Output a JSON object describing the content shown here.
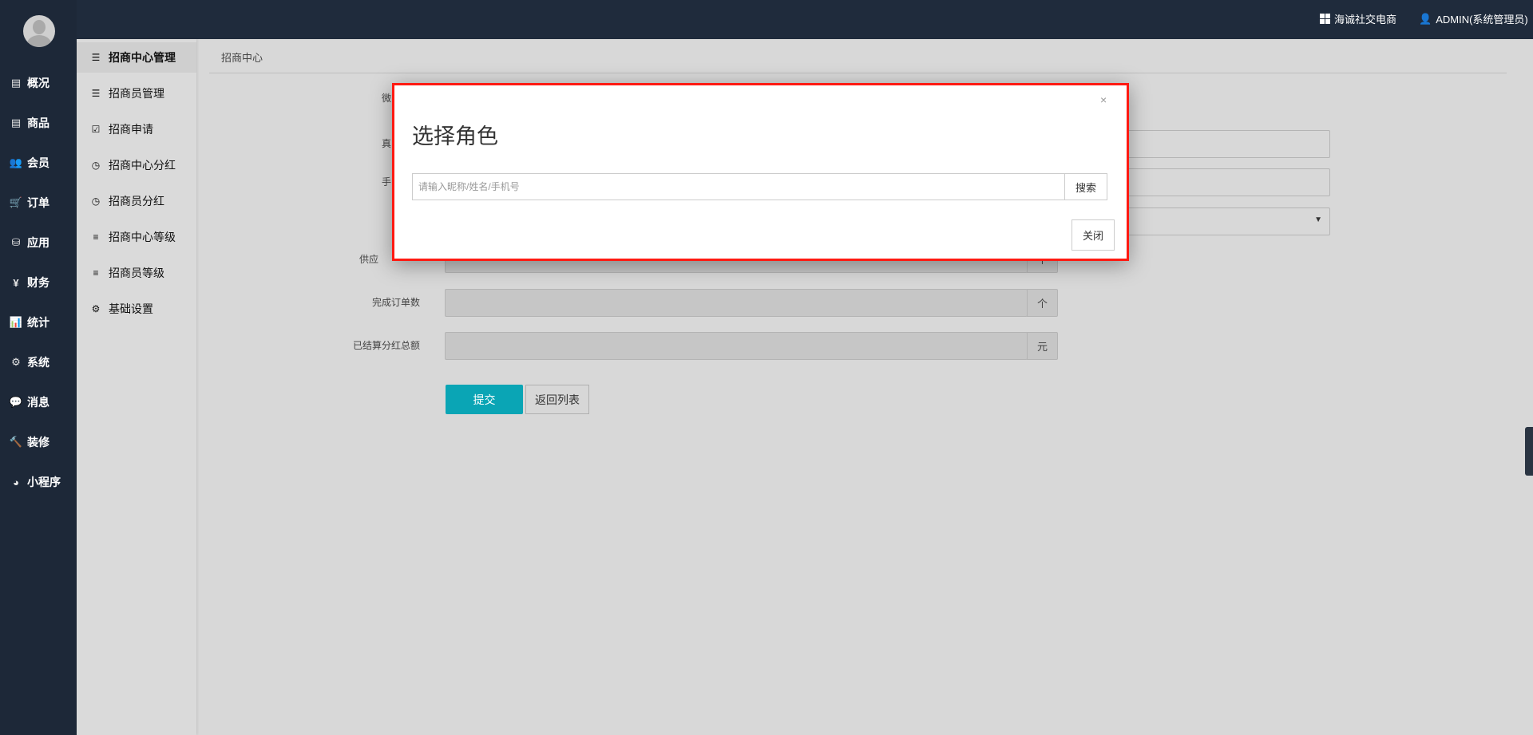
{
  "topbar": {
    "shop_name": "海诚社交电商",
    "user": "ADMIN(系统管理员)",
    "shop_icon": "dashboard-grid-icon",
    "user_icon": "user-icon"
  },
  "leftnav": [
    {
      "label": "概况",
      "icon": "archive-icon",
      "glyph": "▤"
    },
    {
      "label": "商品",
      "icon": "archive-icon",
      "glyph": "▤"
    },
    {
      "label": "会员",
      "icon": "users-icon",
      "glyph": "👥"
    },
    {
      "label": "订单",
      "icon": "cart-icon",
      "glyph": "🛒"
    },
    {
      "label": "应用",
      "icon": "cubes-icon",
      "glyph": "⛁"
    },
    {
      "label": "财务",
      "icon": "yen-icon",
      "glyph": "¥"
    },
    {
      "label": "统计",
      "icon": "bar-chart-icon",
      "glyph": "📊"
    },
    {
      "label": "系统",
      "icon": "cogs-icon",
      "glyph": "⚙"
    },
    {
      "label": "消息",
      "icon": "comment-icon",
      "glyph": "💬"
    },
    {
      "label": "装修",
      "icon": "gavel-icon",
      "glyph": "🔨"
    },
    {
      "label": "小程序",
      "icon": "wechat-icon",
      "glyph": "◕"
    }
  ],
  "subnav": [
    {
      "label": "招商中心管理",
      "icon": "list-icon",
      "glyph": "☰",
      "active": true
    },
    {
      "label": "招商员管理",
      "icon": "list-icon",
      "glyph": "☰"
    },
    {
      "label": "招商申请",
      "icon": "check-square-icon",
      "glyph": "☑"
    },
    {
      "label": "招商中心分红",
      "icon": "clock-icon",
      "glyph": "◷"
    },
    {
      "label": "招商员分红",
      "icon": "clock-icon",
      "glyph": "◷"
    },
    {
      "label": "招商中心等级",
      "icon": "align-left-icon",
      "glyph": "≡"
    },
    {
      "label": "招商员等级",
      "icon": "align-left-icon",
      "glyph": "≡"
    },
    {
      "label": "基础设置",
      "icon": "cogs-icon",
      "glyph": "⚙"
    }
  ],
  "breadcrumb": "招商中心",
  "form": {
    "label_fragments": [
      "微",
      "真",
      "手",
      "供应"
    ],
    "completed_orders_label": "完成订单数",
    "completed_orders_unit": "个",
    "settled_dividend_label": "已结算分红总额",
    "settled_dividend_unit": "元",
    "supplier_unit": "个",
    "submit": "提交",
    "back": "返回列表"
  },
  "modal": {
    "title": "选择角色",
    "close_glyph": "×",
    "search_placeholder": "请输入昵称/姓名/手机号",
    "search_button": "搜索",
    "close_button": "关闭"
  }
}
